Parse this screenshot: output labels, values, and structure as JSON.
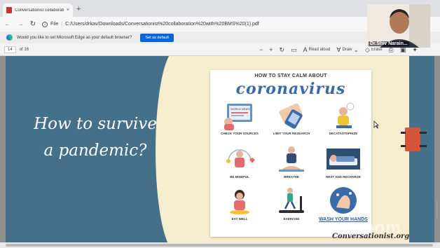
{
  "browser": {
    "tab_title": "Conversationist collaboration w",
    "tab_close": "×",
    "new_tab": "+",
    "address_label": "File",
    "address_url": "C:/Users/drkav/Downloads/Conversationist%20collaboration%20with%20BMS%20(1).pdf"
  },
  "infobar": {
    "message": "Would you like to set Microsoft Edge as your default browser?",
    "button_label": "Set as default"
  },
  "pdf_toolbar": {
    "page_current": "14",
    "page_total": "of 16",
    "zoom_out": "−",
    "zoom_in": "+",
    "read_aloud_label": "Read aloud",
    "draw_label": "Draw",
    "erase_label": "Erase"
  },
  "slide": {
    "headline_line1": "How to survive",
    "headline_line2": "a pandemic?",
    "poster_title_small": "HOW TO STAY CALM ABOUT",
    "poster_title_big": "coronavirus",
    "tips": [
      "CHECK YOUR SOURCES",
      "LIMIT YOUR RESEARCH",
      "DECATASTOPHIZE",
      "BE MINDFUL",
      "BREATHE",
      "REST AND RECHARGE",
      "EAT WELL",
      "EXERCISE",
      "WASH YOUR HANDS"
    ],
    "poster_small_text": "WORLD NEWS",
    "caption": "Conversationist.org"
  },
  "webcam": {
    "name": "Dr.Shiv Narain..."
  },
  "watermark": "zoom",
  "colors": {
    "slide_blue": "#44708a",
    "slide_cream": "#f6ecce",
    "accent_blue": "#0a66d8",
    "poster_title": "#3a6aa8",
    "tab_pdf_icon": "#c8322b"
  }
}
